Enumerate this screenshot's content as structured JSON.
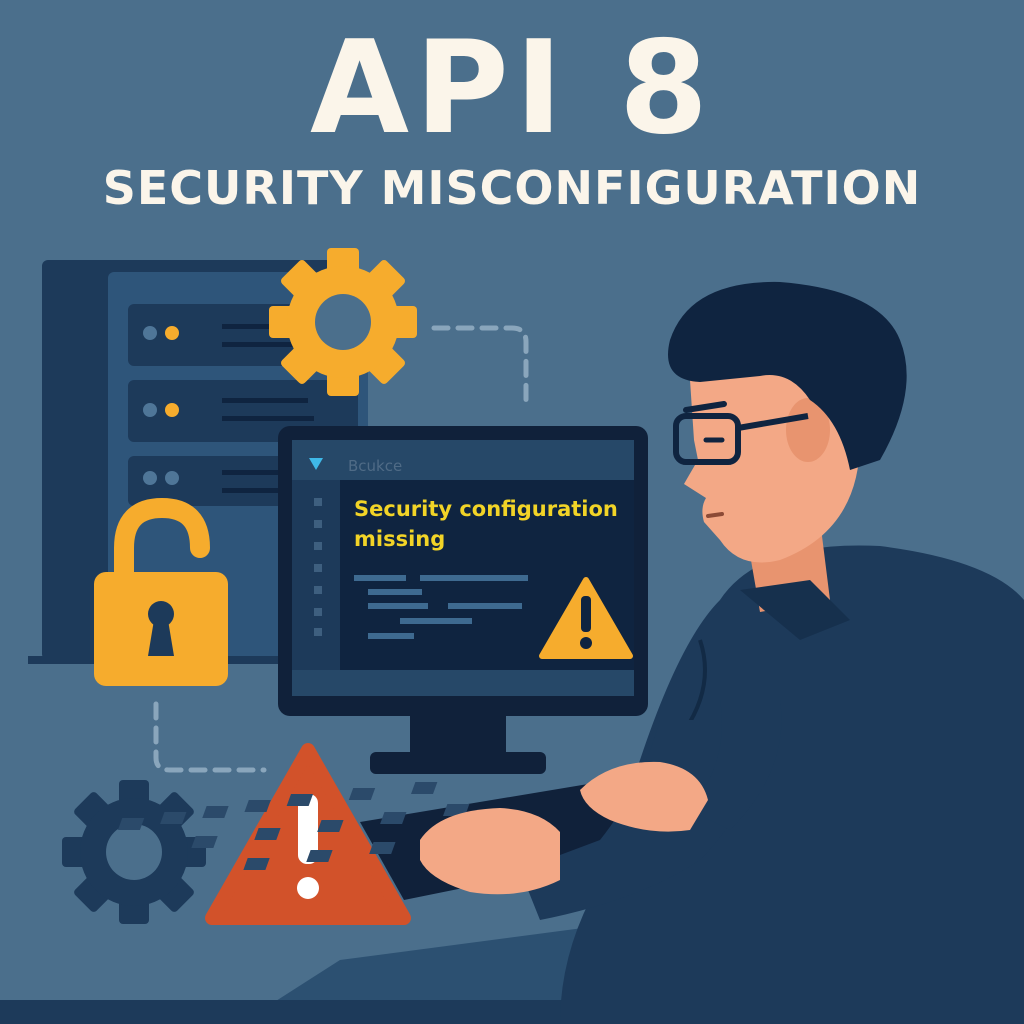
{
  "header": {
    "title": "API 8",
    "subtitle": "SECURITY MISCONFIGURATION"
  },
  "monitor": {
    "tab_label": "Bcukce",
    "message": "Security configuration missing"
  },
  "colors": {
    "background": "#4b6f8c",
    "title_text": "#fbf5ea",
    "accent_yellow": "#f6ac2d",
    "warning_red": "#d2522a",
    "message_text": "#f2d427",
    "navy": "#1d3a5a",
    "skin": "#f3a886"
  },
  "icons": [
    "gear-icon",
    "server-rack-icon",
    "unlocked-padlock-icon",
    "warning-triangle-icon",
    "chevron-down-icon"
  ]
}
